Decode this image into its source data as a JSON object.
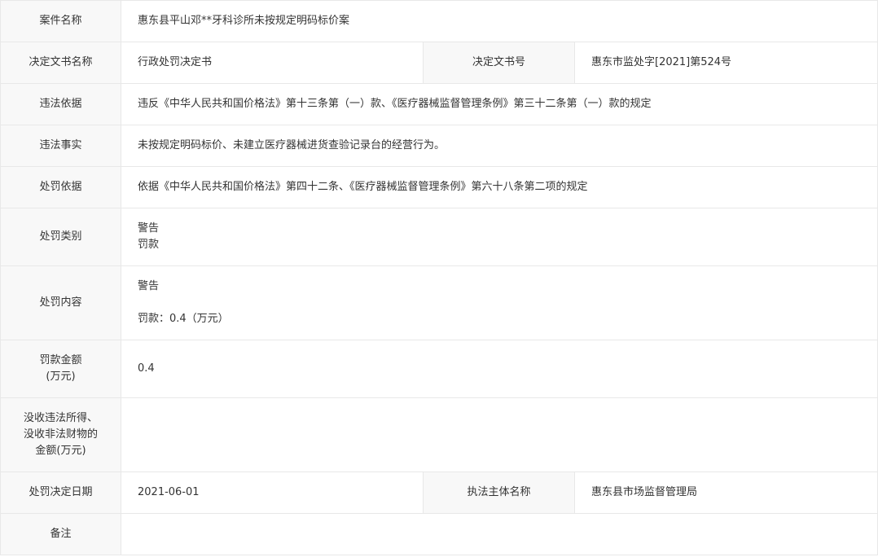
{
  "rows": {
    "case_name": {
      "label": "案件名称",
      "value": "惠东县平山邓**牙科诊所未按规定明码标价案"
    },
    "doc_name": {
      "label": "决定文书名称",
      "value": "行政处罚决定书"
    },
    "doc_number": {
      "label": "决定文书号",
      "value": "惠东市监处字[2021]第524号"
    },
    "violation_basis": {
      "label": "违法依据",
      "value": "违反《中华人民共和国价格法》第十三条第（一）款、《医疗器械监督管理条例》第三十二条第（一）款的规定"
    },
    "violation_facts": {
      "label": "违法事实",
      "value": "未按规定明码标价、未建立医疗器械进货查验记录台的经营行为。"
    },
    "penalty_basis": {
      "label": "处罚依据",
      "value": "依据《中华人民共和国价格法》第四十二条、《医疗器械监督管理条例》第六十八条第二项的规定"
    },
    "penalty_type": {
      "label": "处罚类别",
      "values": [
        "警告",
        "罚款"
      ]
    },
    "penalty_content": {
      "label": "处罚内容",
      "line1": "警告",
      "line2": "罚款：0.4（万元）"
    },
    "fine_amount": {
      "label_line1": "罚款金额",
      "label_line2": "(万元)",
      "value": "0.4"
    },
    "confiscation": {
      "label_lines": [
        "没收违法所得、",
        "没收非法财物的",
        "金额(万元)"
      ],
      "value": ""
    },
    "decision_date": {
      "label": "处罚决定日期",
      "value": "2021-06-01"
    },
    "enforcer": {
      "label": "执法主体名称",
      "value": "惠东县市场监督管理局"
    },
    "remarks": {
      "label": "备注",
      "value": ""
    }
  }
}
